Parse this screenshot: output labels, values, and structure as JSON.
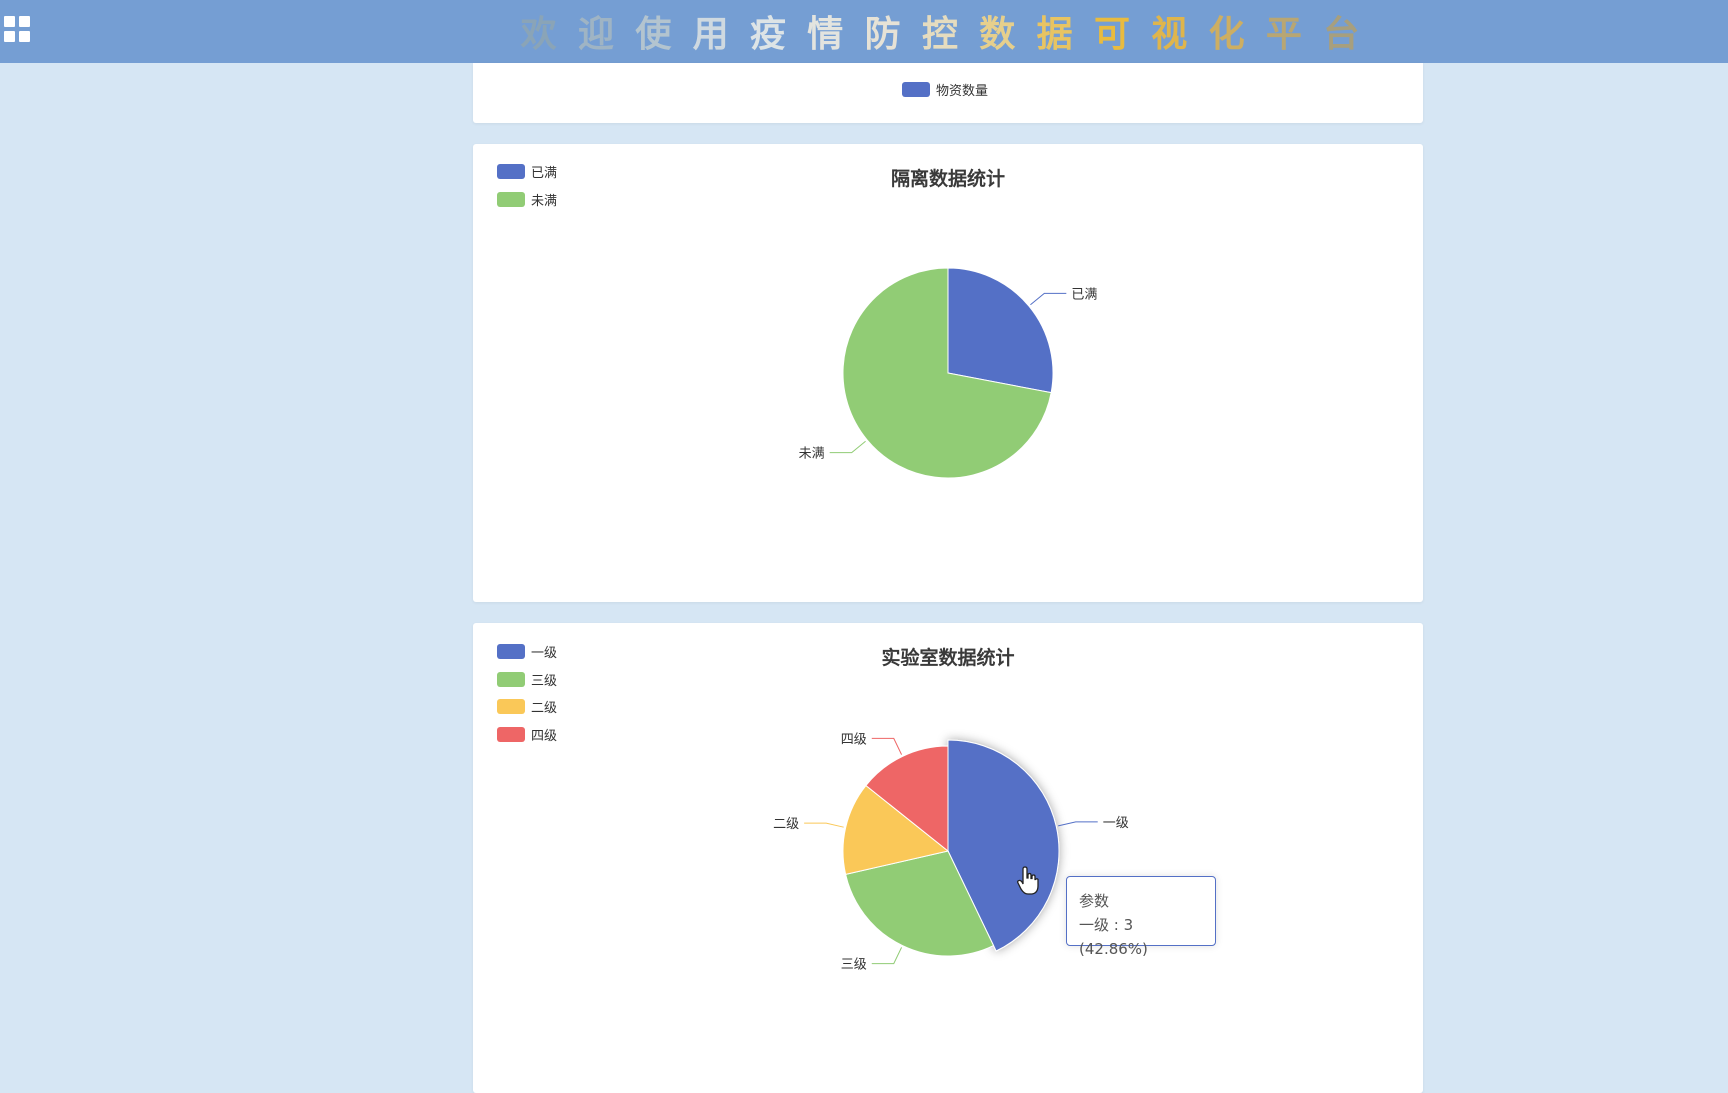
{
  "header": {
    "title_chars": [
      {
        "ch": "欢",
        "color": "#8aa4b7"
      },
      {
        "ch": "迎",
        "color": "#9fb4c4"
      },
      {
        "ch": "使",
        "color": "#b3c4cf"
      },
      {
        "ch": "用",
        "color": "#cfd9e0"
      },
      {
        "ch": "疫",
        "color": "#dde4e6"
      },
      {
        "ch": "情",
        "color": "#e3e4df"
      },
      {
        "ch": "防",
        "color": "#e6e2d6"
      },
      {
        "ch": "控",
        "color": "#e5dcbf"
      },
      {
        "ch": "数",
        "color": "#e6cf8c"
      },
      {
        "ch": "据",
        "color": "#e8c462"
      },
      {
        "ch": "可",
        "color": "#e9bb3f"
      },
      {
        "ch": "视",
        "color": "#dfb54c"
      },
      {
        "ch": "化",
        "color": "#cdae62"
      },
      {
        "ch": "平",
        "color": "#b8a673"
      },
      {
        "ch": "台",
        "color": "#a79f7e"
      }
    ]
  },
  "top_card": {
    "legend_label": "物资数量",
    "legend_color": "#5470c6"
  },
  "colors": {
    "blue": "#5470c6",
    "green": "#91cc75",
    "yellow": "#fac858",
    "red": "#ee6666"
  },
  "chart_data": [
    {
      "type": "pie",
      "title": "隔离数据统计",
      "legend": [
        "已满",
        "未满"
      ],
      "legend_position": "top-left",
      "categories": [
        "已满",
        "未满"
      ],
      "values": [
        28,
        72
      ],
      "colors": [
        "#5470c6",
        "#91cc75"
      ]
    },
    {
      "type": "pie",
      "title": "实验室数据统计",
      "legend": [
        "一级",
        "三级",
        "二级",
        "四级"
      ],
      "legend_position": "top-left",
      "categories": [
        "一级",
        "三级",
        "二级",
        "四级"
      ],
      "values": [
        3,
        2,
        1,
        1
      ],
      "colors": [
        "#5470c6",
        "#91cc75",
        "#fac858",
        "#ee6666"
      ],
      "tooltip": {
        "title": "参数",
        "line": "一级 : 3 (42.86%)"
      }
    }
  ]
}
